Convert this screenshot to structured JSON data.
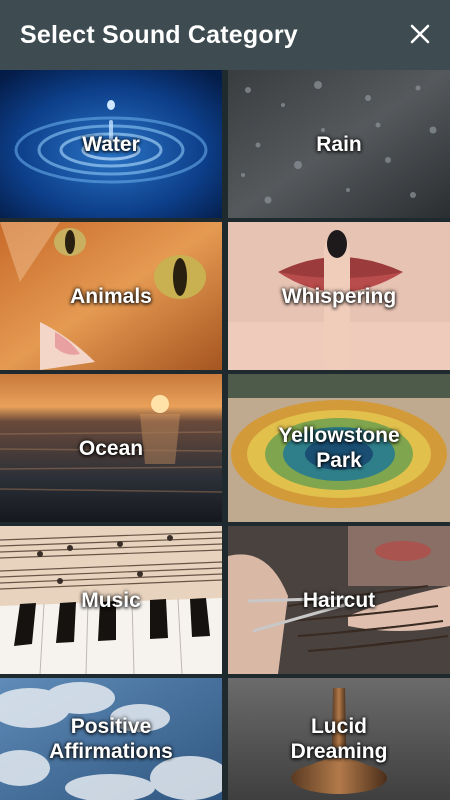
{
  "dialog": {
    "title": "Select Sound Category",
    "close_icon": "close-icon"
  },
  "categories": [
    {
      "id": "water",
      "label": "Water"
    },
    {
      "id": "rain",
      "label": "Rain"
    },
    {
      "id": "animals",
      "label": "Animals"
    },
    {
      "id": "whispering",
      "label": "Whispering"
    },
    {
      "id": "ocean",
      "label": "Ocean"
    },
    {
      "id": "yellowstone-park",
      "label": "Yellowstone\nPark"
    },
    {
      "id": "music",
      "label": "Music"
    },
    {
      "id": "haircut",
      "label": "Haircut"
    },
    {
      "id": "positive-affirmations",
      "label": "Positive\nAffirmations"
    },
    {
      "id": "lucid-dreaming",
      "label": "Lucid\nDreaming"
    }
  ],
  "colors": {
    "header_bg": "#3e4c51",
    "title_text": "#ffffff"
  }
}
